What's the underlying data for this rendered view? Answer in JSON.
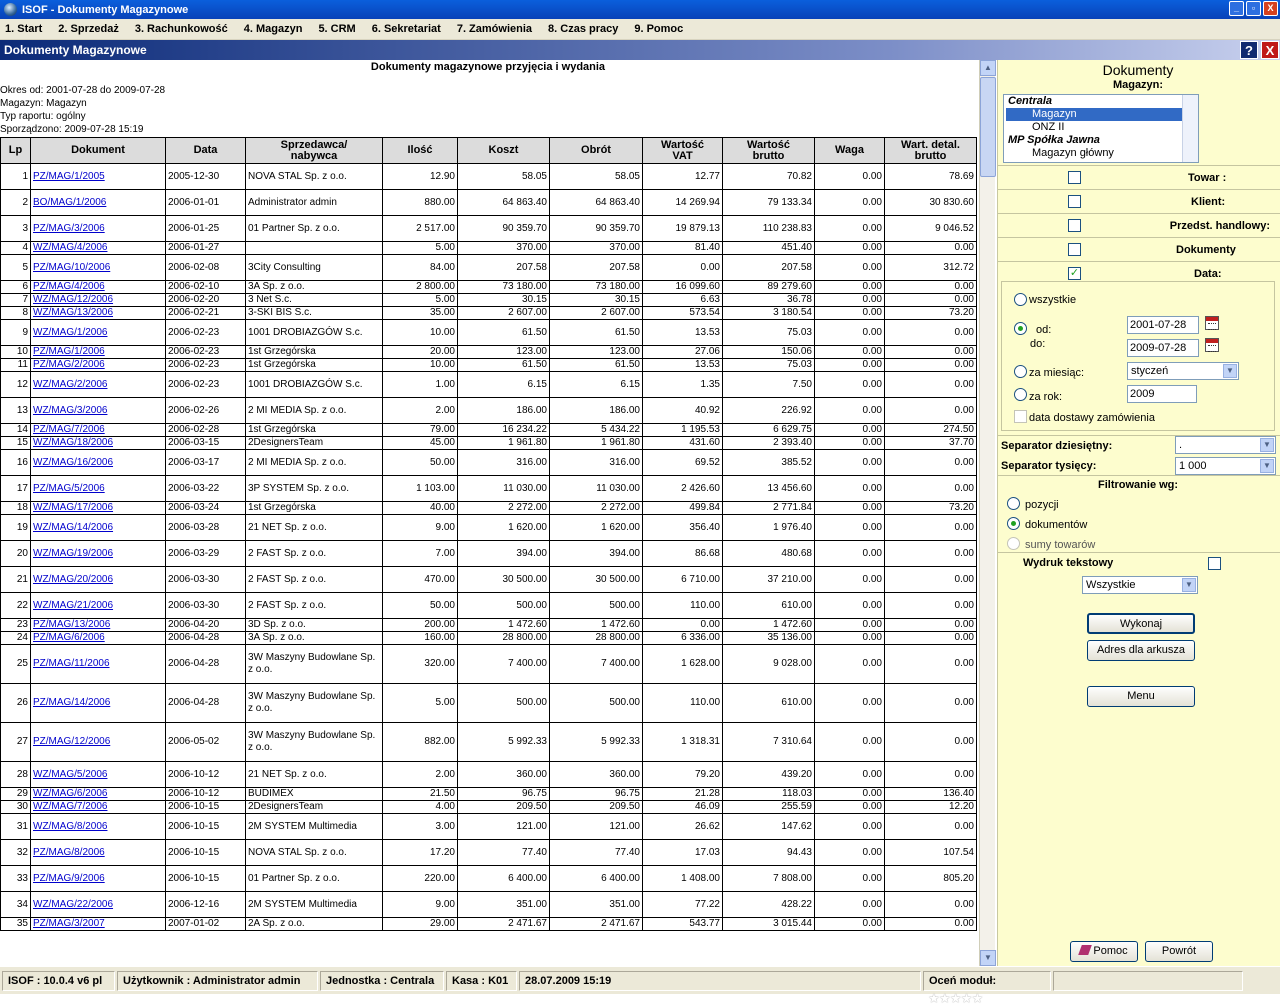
{
  "window": {
    "title": "ISOF - Dokumenty Magazynowe",
    "minimize": "_",
    "maximize": "▫",
    "close": "X"
  },
  "menu": [
    "1. Start",
    "2. Sprzedaż",
    "3. Rachunkowość",
    "4. Magazyn",
    "5. CRM",
    "6. Sekretariat",
    "7. Zamówienia",
    "8. Czas pracy",
    "9. Pomoc"
  ],
  "doc_header": {
    "title": "Dokumenty Magazynowe",
    "help": "?",
    "close": "X"
  },
  "report": {
    "title": "Dokumenty magazynowe przyjęcia i wydania",
    "period": "Okres od: 2001-07-28 do 2009-07-28",
    "warehouse": "Magazyn: Magazyn",
    "type": "Typ raportu: ogólny",
    "created": "Sporządzono: 2009-07-28 15:19"
  },
  "table": {
    "headers": [
      "Lp",
      "Dokument",
      "Data",
      "Sprzedawca/\nnabywca",
      "Ilość",
      "Koszt",
      "Obrót",
      "Wartość\nVAT",
      "Wartość\nbrutto",
      "Waga",
      "Wart. detal.\nbrutto"
    ],
    "rows": [
      [
        "1",
        "PZ/MAG/1/2005",
        "2005-12-30",
        "NOVA STAL Sp. z o.o.",
        "12.90",
        "58.05",
        "58.05",
        "12.77",
        "70.82",
        "0.00",
        "78.69"
      ],
      [
        "2",
        "BO/MAG/1/2006",
        "2006-01-01",
        "Administrator admin",
        "880.00",
        "64 863.40",
        "64 863.40",
        "14 269.94",
        "79 133.34",
        "0.00",
        "30 830.60"
      ],
      [
        "3",
        "PZ/MAG/3/2006",
        "2006-01-25",
        "01 Partner Sp. z o.o.",
        "2 517.00",
        "90 359.70",
        "90 359.70",
        "19 879.13",
        "110 238.83",
        "0.00",
        "9 046.52"
      ],
      [
        "4",
        "WZ/MAG/4/2006",
        "2006-01-27",
        "",
        "5.00",
        "370.00",
        "370.00",
        "81.40",
        "451.40",
        "0.00",
        "0.00"
      ],
      [
        "5",
        "PZ/MAG/10/2006",
        "2006-02-08",
        "3City Consulting",
        "84.00",
        "207.58",
        "207.58",
        "0.00",
        "207.58",
        "0.00",
        "312.72"
      ],
      [
        "6",
        "PZ/MAG/4/2006",
        "2006-02-10",
        "3A Sp. z o.o.",
        "2 800.00",
        "73 180.00",
        "73 180.00",
        "16 099.60",
        "89 279.60",
        "0.00",
        "0.00"
      ],
      [
        "7",
        "WZ/MAG/12/2006",
        "2006-02-20",
        "3 Net S.c.",
        "5.00",
        "30.15",
        "30.15",
        "6.63",
        "36.78",
        "0.00",
        "0.00"
      ],
      [
        "8",
        "WZ/MAG/13/2006",
        "2006-02-21",
        "3-SKI BIS S.c.",
        "35.00",
        "2 607.00",
        "2 607.00",
        "573.54",
        "3 180.54",
        "0.00",
        "73.20"
      ],
      [
        "9",
        "WZ/MAG/1/2006",
        "2006-02-23",
        "1001 DROBIAZGÓW S.c.",
        "10.00",
        "61.50",
        "61.50",
        "13.53",
        "75.03",
        "0.00",
        "0.00"
      ],
      [
        "10",
        "PZ/MAG/1/2006",
        "2006-02-23",
        "1st Grzegórska",
        "20.00",
        "123.00",
        "123.00",
        "27.06",
        "150.06",
        "0.00",
        "0.00"
      ],
      [
        "11",
        "PZ/MAG/2/2006",
        "2006-02-23",
        "1st Grzegórska",
        "10.00",
        "61.50",
        "61.50",
        "13.53",
        "75.03",
        "0.00",
        "0.00"
      ],
      [
        "12",
        "WZ/MAG/2/2006",
        "2006-02-23",
        "1001 DROBIAZGÓW S.c.",
        "1.00",
        "6.15",
        "6.15",
        "1.35",
        "7.50",
        "0.00",
        "0.00"
      ],
      [
        "13",
        "WZ/MAG/3/2006",
        "2006-02-26",
        "2 MI MEDIA Sp. z o.o.",
        "2.00",
        "186.00",
        "186.00",
        "40.92",
        "226.92",
        "0.00",
        "0.00"
      ],
      [
        "14",
        "PZ/MAG/7/2006",
        "2006-02-28",
        "1st Grzegórska",
        "79.00",
        "16 234.22",
        "5 434.22",
        "1 195.53",
        "6 629.75",
        "0.00",
        "274.50"
      ],
      [
        "15",
        "WZ/MAG/18/2006",
        "2006-03-15",
        "2DesignersTeam",
        "45.00",
        "1 961.80",
        "1 961.80",
        "431.60",
        "2 393.40",
        "0.00",
        "37.70"
      ],
      [
        "16",
        "WZ/MAG/16/2006",
        "2006-03-17",
        "2 MI MEDIA Sp. z o.o.",
        "50.00",
        "316.00",
        "316.00",
        "69.52",
        "385.52",
        "0.00",
        "0.00"
      ],
      [
        "17",
        "PZ/MAG/5/2006",
        "2006-03-22",
        "3P SYSTEM Sp. z o.o.",
        "1 103.00",
        "11 030.00",
        "11 030.00",
        "2 426.60",
        "13 456.60",
        "0.00",
        "0.00"
      ],
      [
        "18",
        "WZ/MAG/17/2006",
        "2006-03-24",
        "1st Grzegórska",
        "40.00",
        "2 272.00",
        "2 272.00",
        "499.84",
        "2 771.84",
        "0.00",
        "73.20"
      ],
      [
        "19",
        "WZ/MAG/14/2006",
        "2006-03-28",
        "21 NET Sp. z o.o.",
        "9.00",
        "1 620.00",
        "1 620.00",
        "356.40",
        "1 976.40",
        "0.00",
        "0.00"
      ],
      [
        "20",
        "WZ/MAG/19/2006",
        "2006-03-29",
        "2 FAST Sp. z o.o.",
        "7.00",
        "394.00",
        "394.00",
        "86.68",
        "480.68",
        "0.00",
        "0.00"
      ],
      [
        "21",
        "WZ/MAG/20/2006",
        "2006-03-30",
        "2 FAST Sp. z o.o.",
        "470.00",
        "30 500.00",
        "30 500.00",
        "6 710.00",
        "37 210.00",
        "0.00",
        "0.00"
      ],
      [
        "22",
        "WZ/MAG/21/2006",
        "2006-03-30",
        "2 FAST Sp. z o.o.",
        "50.00",
        "500.00",
        "500.00",
        "110.00",
        "610.00",
        "0.00",
        "0.00"
      ],
      [
        "23",
        "PZ/MAG/13/2006",
        "2006-04-20",
        "3D Sp. z o.o.",
        "200.00",
        "1 472.60",
        "1 472.60",
        "0.00",
        "1 472.60",
        "0.00",
        "0.00"
      ],
      [
        "24",
        "PZ/MAG/6/2006",
        "2006-04-28",
        "3A Sp. z o.o.",
        "160.00",
        "28 800.00",
        "28 800.00",
        "6 336.00",
        "35 136.00",
        "0.00",
        "0.00"
      ],
      [
        "25",
        "PZ/MAG/11/2006",
        "2006-04-28",
        "3W Maszyny Budowlane Sp. z o.o.",
        "320.00",
        "7 400.00",
        "7 400.00",
        "1 628.00",
        "9 028.00",
        "0.00",
        "0.00"
      ],
      [
        "26",
        "PZ/MAG/14/2006",
        "2006-04-28",
        "3W Maszyny Budowlane Sp. z o.o.",
        "5.00",
        "500.00",
        "500.00",
        "110.00",
        "610.00",
        "0.00",
        "0.00"
      ],
      [
        "27",
        "PZ/MAG/12/2006",
        "2006-05-02",
        "3W Maszyny Budowlane Sp. z o.o.",
        "882.00",
        "5 992.33",
        "5 992.33",
        "1 318.31",
        "7 310.64",
        "0.00",
        "0.00"
      ],
      [
        "28",
        "WZ/MAG/5/2006",
        "2006-10-12",
        "21 NET Sp. z o.o.",
        "2.00",
        "360.00",
        "360.00",
        "79.20",
        "439.20",
        "0.00",
        "0.00"
      ],
      [
        "29",
        "WZ/MAG/6/2006",
        "2006-10-12",
        "BUDIMEX",
        "21.50",
        "96.75",
        "96.75",
        "21.28",
        "118.03",
        "0.00",
        "136.40"
      ],
      [
        "30",
        "WZ/MAG/7/2006",
        "2006-10-15",
        "2DesignersTeam",
        "4.00",
        "209.50",
        "209.50",
        "46.09",
        "255.59",
        "0.00",
        "12.20"
      ],
      [
        "31",
        "WZ/MAG/8/2006",
        "2006-10-15",
        "2M SYSTEM Multimedia",
        "3.00",
        "121.00",
        "121.00",
        "26.62",
        "147.62",
        "0.00",
        "0.00"
      ],
      [
        "32",
        "PZ/MAG/8/2006",
        "2006-10-15",
        "NOVA STAL Sp. z o.o.",
        "17.20",
        "77.40",
        "77.40",
        "17.03",
        "94.43",
        "0.00",
        "107.54"
      ],
      [
        "33",
        "PZ/MAG/9/2006",
        "2006-10-15",
        "01 Partner Sp. z o.o.",
        "220.00",
        "6 400.00",
        "6 400.00",
        "1 408.00",
        "7 808.00",
        "0.00",
        "805.20"
      ],
      [
        "34",
        "WZ/MAG/22/2006",
        "2006-12-16",
        "2M SYSTEM Multimedia",
        "9.00",
        "351.00",
        "351.00",
        "77.22",
        "428.22",
        "0.00",
        "0.00"
      ],
      [
        "35",
        "PZ/MAG/3/2007",
        "2007-01-02",
        "2A Sp. z o.o.",
        "29.00",
        "2 471.67",
        "2 471.67",
        "543.77",
        "3 015.44",
        "0.00",
        "0.00"
      ]
    ]
  },
  "sidebar": {
    "title": "Dokumenty",
    "warehouse_label": "Magazyn:",
    "warehouse_list": [
      {
        "text": "Centrala",
        "kind": "grp"
      },
      {
        "text": "Magazyn",
        "kind": "sel"
      },
      {
        "text": "ONZ II",
        "kind": "child"
      },
      {
        "text": "MP Spółka Jawna",
        "kind": "grp"
      },
      {
        "text": "Magazyn główny",
        "kind": "child"
      }
    ],
    "filters": [
      {
        "label": "Towar :",
        "checked": false
      },
      {
        "label": "Klient:",
        "checked": false
      },
      {
        "label": "Przedst. handlowy:",
        "checked": false
      },
      {
        "label": "Dokumenty",
        "checked": false
      },
      {
        "label": "Data:",
        "checked": true
      }
    ],
    "date": {
      "all": "wszystkie",
      "from_label": "od:",
      "to_label": "do:",
      "from": "2001-07-28",
      "to": "2009-07-28",
      "month_label": "za miesiąc:",
      "month": "styczeń",
      "year_label": "za rok:",
      "year": "2009",
      "delivery": "data dostawy zamówienia",
      "selected": "range"
    },
    "decimal_sep_label": "Separator dziesiętny:",
    "decimal_sep": ".",
    "thousand_sep_label": "Separator tysięcy:",
    "thousand_sep": "1 000",
    "filter_by_label": "Filtrowanie wg:",
    "filter_by": [
      "pozycji",
      "dokumentów",
      "sumy towarów"
    ],
    "filter_by_selected": 1,
    "text_print_label": "Wydruk tekstowy",
    "text_print_select": "Wszystkie",
    "btn_run": "Wykonaj",
    "btn_address": "Adres dla arkusza",
    "btn_menu": "Menu",
    "btn_help": "Pomoc",
    "btn_back": "Powrót"
  },
  "status": {
    "version": "ISOF : 10.0.4 v6 pl",
    "user": "Użytkownik : Administrator admin",
    "unit": "Jednostka : Centrala",
    "cash": "Kasa : K01",
    "datetime": "28.07.2009 15:19",
    "rate_label": "Oceń moduł:",
    "stars": "★★★★★"
  }
}
